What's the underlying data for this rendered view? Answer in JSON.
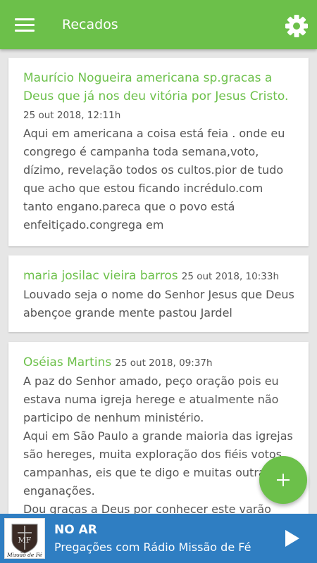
{
  "appbar": {
    "title": "Recados",
    "menu_icon": "menu-icon",
    "settings_icon": "gear-icon"
  },
  "messages": [
    {
      "author": "Maurício Nogueira americana sp.gracas a Deus que já nos deu vitória por Jesus Cristo.",
      "date": "25 out 2018, 12:11h",
      "body": "Aqui em americana a coisa está feia . onde eu congrego é campanha toda semana,voto, dízimo, revelação todos os cultos.pior de tudo que acho que estou ficando incrédulo.com tanto engano.pareca que o povo está enfeitiçado.congrega em"
    },
    {
      "author": "maria josilac vieira barros",
      "date": "25 out 2018, 10:33h",
      "body": "Louvado seja o nome do Senhor Jesus que Deus abençoe grande mente pastou Jardel"
    },
    {
      "author": "Oséias Martins",
      "date": "25 out 2018, 09:37h",
      "body": "A paz do Senhor amado, peço oração pois eu estava numa igreja herege e atualmente não participo de nenhum ministério.\nAqui em São Paulo a grande maioria das igrejas são hereges, muita exploração dos fiéis votos, campanhas, eis que te digo e muitas outras enganações.\nDou graças a Deus por conhecer este varão"
    }
  ],
  "fab": {
    "icon": "plus-icon"
  },
  "player": {
    "live_label": "NO AR",
    "program": "Pregações com Rádio Missão de Fé",
    "logo_text": "Missão de Fé",
    "logo_monogram": "MF",
    "play_icon": "play-icon"
  },
  "colors": {
    "primary": "#6cc04a",
    "player": "#2f7ec2",
    "background": "#e6e6e6"
  }
}
